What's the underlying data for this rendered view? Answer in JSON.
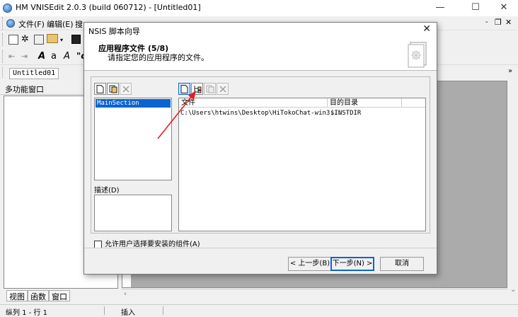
{
  "app": {
    "title": "HM VNISEdit 2.0.3 (build 060712) - [Untitled01]",
    "window_controls": {
      "minimize": "—",
      "maximize": "☐",
      "close": "✕"
    },
    "mdi_controls": {
      "minimize": "-",
      "restore": "❐",
      "close": "✕"
    }
  },
  "menu": {
    "items": [
      "文件(F)",
      "编辑(E)",
      "搜"
    ]
  },
  "toolbar2": {
    "labels": [
      "A",
      "a",
      "A",
      "\"c"
    ]
  },
  "tabs": {
    "document": "Untitled01",
    "overflow": "»"
  },
  "side_panel": {
    "title": "多功能窗口",
    "tabs": [
      "视图",
      "函数",
      "窗口"
    ]
  },
  "statusbar": {
    "position": "纵列 1 - 行 1",
    "mode": "插入"
  },
  "dialog": {
    "title": "NSIS 脚本向导",
    "close": "✕",
    "heading": "应用程序文件 (5/8)",
    "subheading": "请指定您的应用程序的文件。",
    "section_list": {
      "items": [
        "MainSection"
      ],
      "selected": "MainSection"
    },
    "description_label": "描述(D)",
    "file_list": {
      "columns": [
        "文件",
        "目的目录"
      ],
      "rows": [
        {
          "file": "C:\\Users\\htwins\\Desktop\\HiTokoChat-win3...",
          "dest": "$INSTDIR"
        }
      ]
    },
    "checkbox_label": "允许用户选择要安装的组件(A)",
    "buttons": {
      "back": "< 上一步(B)",
      "next": "下一步(N) >",
      "cancel": "取消"
    }
  },
  "colors": {
    "selection": "#0a64d2",
    "annotation_arrow": "#e02020"
  }
}
